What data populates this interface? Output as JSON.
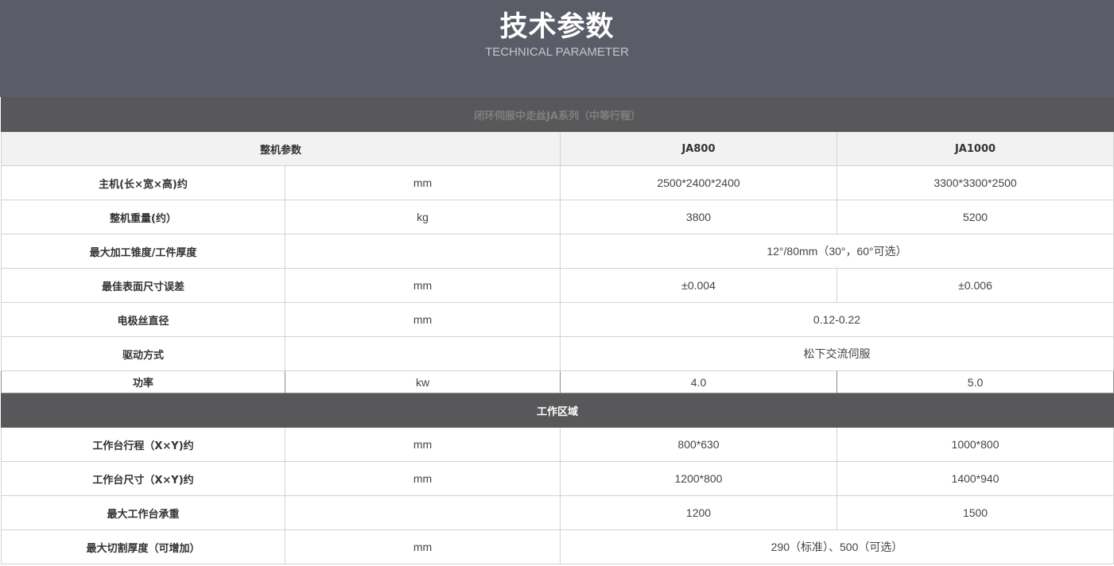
{
  "header": {
    "title": "技术参数",
    "subtitle": "TECHNICAL PARAMETER"
  },
  "table": {
    "series_title": "闭环伺服中走丝JA系列（中等行程）",
    "col_header": {
      "label": "整机参数",
      "model_a": "JA800",
      "model_b": "JA1000"
    },
    "machine_rows": [
      {
        "name": "主机(长×宽×高)约",
        "unit": "mm",
        "a": "2500*2400*2400",
        "b": "3300*3300*2500"
      },
      {
        "name": "整机重量(约）",
        "unit": "kg",
        "a": "3800",
        "b": "5200"
      },
      {
        "name": "最大加工锥度/工件厚度",
        "unit": "",
        "shared": "12°/80mm（30°，60°可选）"
      },
      {
        "name": "最佳表面尺寸误差",
        "unit": "mm",
        "a": "±0.004",
        "b": "±0.006"
      },
      {
        "name": "电极丝直径",
        "unit": "mm",
        "shared": "0.12-0.22"
      },
      {
        "name": "驱动方式",
        "unit": "",
        "shared": "松下交流伺服"
      },
      {
        "name": "功率",
        "unit": "kw",
        "a": "4.0",
        "b": "5.0"
      }
    ],
    "work_area_title": "工作区域",
    "work_rows": [
      {
        "name": "工作台行程（X×Y)约",
        "unit": "mm",
        "a": "800*630",
        "b": "1000*800"
      },
      {
        "name": "工作台尺寸（X×Y)约",
        "unit": "mm",
        "a": "1200*800",
        "b": "1400*940"
      },
      {
        "name": "最大工作台承重",
        "unit": "",
        "a": "1200",
        "b": "1500"
      },
      {
        "name": "最大切割厚度（可增加）",
        "unit": "mm",
        "shared": "290（标准）、500（可选）"
      }
    ]
  }
}
